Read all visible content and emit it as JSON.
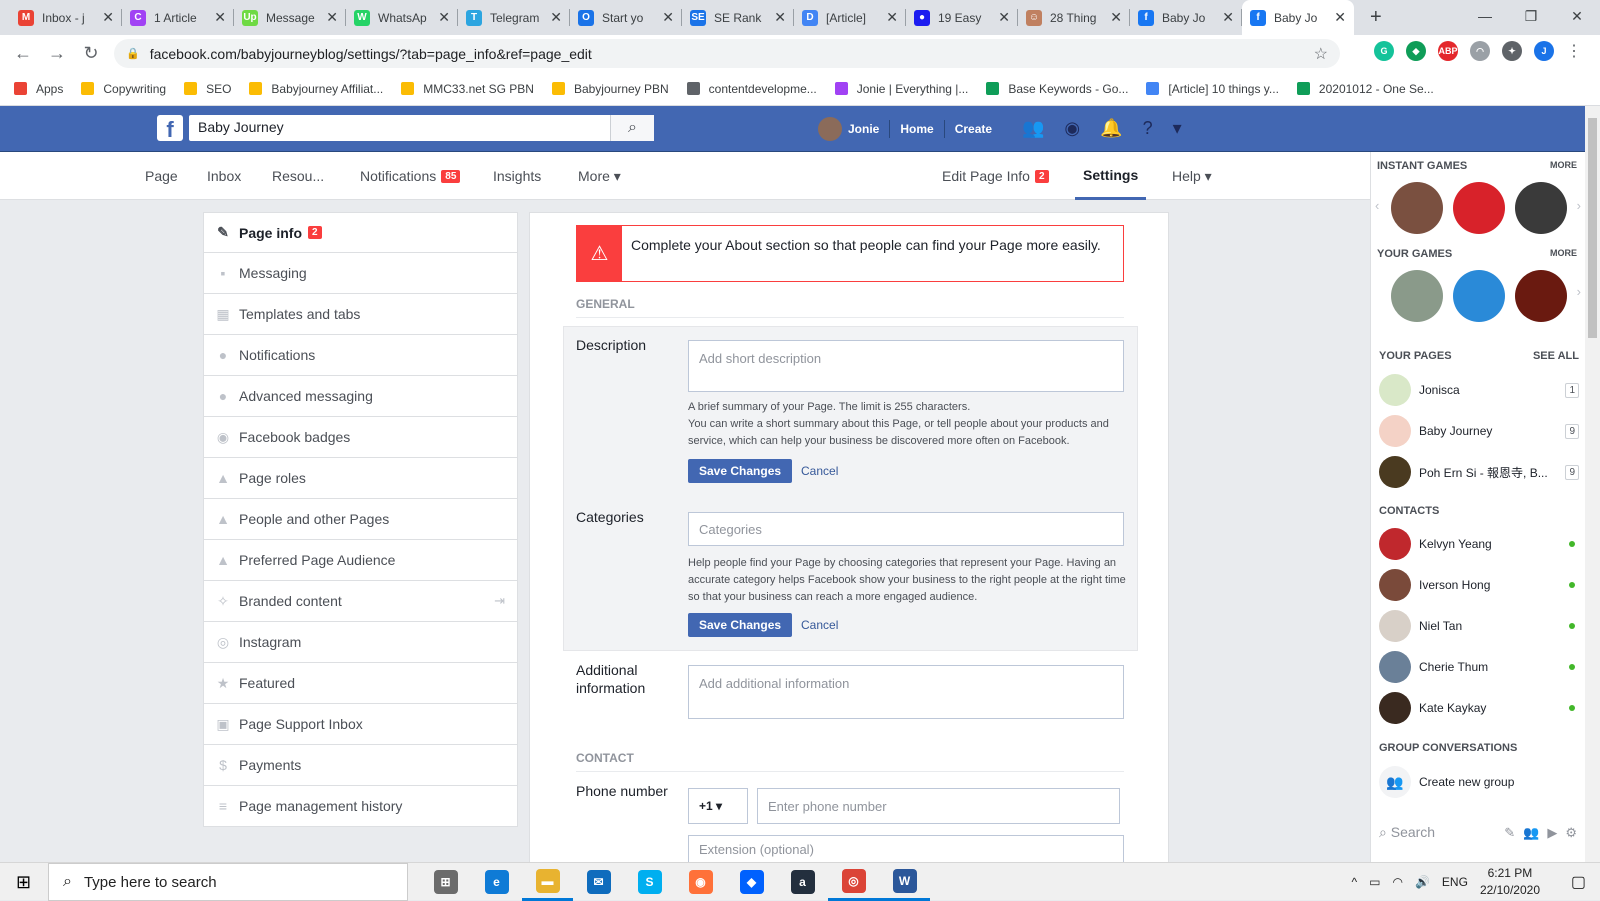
{
  "browser": {
    "tabs": [
      {
        "title": "Inbox - j",
        "color": "#ea4335",
        "glyph": "M",
        "active": false
      },
      {
        "title": "1 Article",
        "color": "#a142f4",
        "glyph": "C",
        "active": false
      },
      {
        "title": "Message",
        "color": "#6fda44",
        "glyph": "Up",
        "active": false
      },
      {
        "title": "WhatsAp",
        "color": "#25d366",
        "glyph": "W",
        "active": false
      },
      {
        "title": "Telegram",
        "color": "#2ca5e0",
        "glyph": "T",
        "active": false
      },
      {
        "title": "Start yo",
        "color": "#1a73e8",
        "glyph": "O",
        "active": false
      },
      {
        "title": "SE Rank",
        "color": "#1a73e8",
        "glyph": "SE",
        "active": false
      },
      {
        "title": "[Article]",
        "color": "#4285f4",
        "glyph": "D",
        "active": false
      },
      {
        "title": "19 Easy",
        "color": "#1c1cf0",
        "glyph": "●",
        "active": false
      },
      {
        "title": "28 Thing",
        "color": "#c08060",
        "glyph": "☺",
        "active": false
      },
      {
        "title": "Baby Jo",
        "color": "#1877f2",
        "glyph": "f",
        "active": false
      },
      {
        "title": "Baby Jo",
        "color": "#1877f2",
        "glyph": "f",
        "active": true
      }
    ],
    "new_tab": "+",
    "url": "facebook.com/babyjourneyblog/settings/?tab=page_info&ref=page_edit",
    "extensions": [
      {
        "glyph": "G",
        "color": "#15c39a"
      },
      {
        "glyph": "◆",
        "color": "#0f9d58"
      },
      {
        "glyph": "ABP",
        "color": "#e4282c"
      },
      {
        "glyph": "◠",
        "color": "#9aa0a6"
      },
      {
        "glyph": "✦",
        "color": "#5f6368"
      },
      {
        "glyph": "J",
        "color": "#1a73e8"
      }
    ],
    "bookmarks": [
      {
        "label": "Apps",
        "color": "#ea4335"
      },
      {
        "label": "Copywriting",
        "color": "#fbbc04"
      },
      {
        "label": "SEO",
        "color": "#fbbc04"
      },
      {
        "label": "Babyjourney Affiliat...",
        "color": "#fbbc04"
      },
      {
        "label": "MMC33.net SG PBN",
        "color": "#fbbc04"
      },
      {
        "label": "Babyjourney PBN",
        "color": "#fbbc04"
      },
      {
        "label": "contentdevelopme...",
        "color": "#5f6368"
      },
      {
        "label": "Jonie | Everything |...",
        "color": "#a142f4"
      },
      {
        "label": "Base Keywords - Go...",
        "color": "#0f9d58"
      },
      {
        "label": "[Article] 10 things y...",
        "color": "#4285f4"
      },
      {
        "label": "20201012 - One Se...",
        "color": "#0f9d58"
      }
    ]
  },
  "fb": {
    "search_value": "Baby Journey",
    "user": "Jonie",
    "home": "Home",
    "create": "Create"
  },
  "page_tabs": {
    "page": "Page",
    "inbox": "Inbox",
    "resources": "Resou...",
    "notifications": "Notifications",
    "notifications_badge": "85",
    "insights": "Insights",
    "more": "More ▾",
    "edit_page_info": "Edit Page Info",
    "edit_badge": "2",
    "settings": "Settings",
    "help": "Help ▾"
  },
  "sidebar": {
    "items": [
      {
        "label": "Page info",
        "icon": "✎",
        "badge": "2",
        "active": true
      },
      {
        "label": "Messaging",
        "icon": "▪",
        "active": false
      },
      {
        "label": "Templates and tabs",
        "icon": "▦",
        "active": false
      },
      {
        "label": "Notifications",
        "icon": "●",
        "active": false
      },
      {
        "label": "Advanced messaging",
        "icon": "●",
        "active": false
      },
      {
        "label": "Facebook badges",
        "icon": "◉",
        "active": false
      },
      {
        "label": "Page roles",
        "icon": "▲",
        "active": false
      },
      {
        "label": "People and other Pages",
        "icon": "▲",
        "active": false
      },
      {
        "label": "Preferred Page Audience",
        "icon": "▲",
        "active": false
      },
      {
        "label": "Branded content",
        "icon": "✧",
        "active": false,
        "trail": "⇥"
      },
      {
        "label": "Instagram",
        "icon": "◎",
        "active": false
      },
      {
        "label": "Featured",
        "icon": "★",
        "active": false
      },
      {
        "label": "Page Support Inbox",
        "icon": "▣",
        "active": false
      },
      {
        "label": "Payments",
        "icon": "$",
        "active": false
      },
      {
        "label": "Page management history",
        "icon": "≡",
        "active": false
      }
    ]
  },
  "main": {
    "alert": "Complete your About section so that people can find your Page more easily.",
    "general_heading": "GENERAL",
    "description_label": "Description",
    "description_placeholder": "Add short description",
    "description_help": "A brief summary of your Page. The limit is 255 characters.\nYou can write a short summary about this Page, or tell people about your products and service, which can help your business be discovered more often on Facebook.",
    "save_changes": "Save Changes",
    "cancel": "Cancel",
    "categories_label": "Categories",
    "categories_placeholder": "Categories",
    "categories_help": "Help people find your Page by choosing categories that represent your Page. Having an accurate category helps Facebook show your business to the right people at the right time so that your business can reach a more engaged audience.",
    "additional_label": "Additional information",
    "additional_placeholder": "Add additional information",
    "contact_heading": "CONTACT",
    "phone_label": "Phone number",
    "country_code": "+1 ▾",
    "phone_placeholder": "Enter phone number",
    "extension_placeholder": "Extension (optional)"
  },
  "right": {
    "instant_games": "INSTANT GAMES",
    "more": "MORE",
    "your_games": "YOUR GAMES",
    "your_pages": "YOUR PAGES",
    "see_all": "SEE ALL",
    "pages": [
      {
        "name": "Jonisca",
        "count": "1",
        "color": "#d9e8c8"
      },
      {
        "name": "Baby Journey",
        "count": "9",
        "color": "#f4d2c6"
      },
      {
        "name": "Poh Ern Si - 報恩寺, B...",
        "count": "9",
        "color": "#4a3a20"
      }
    ],
    "contacts_heading": "CONTACTS",
    "contacts": [
      {
        "name": "Kelvyn Yeang",
        "color": "#c0282d"
      },
      {
        "name": "Iverson Hong",
        "color": "#7a4a3a"
      },
      {
        "name": "Niel Tan",
        "color": "#d8d0c8"
      },
      {
        "name": "Cherie Thum",
        "color": "#6a8098"
      },
      {
        "name": "Kate Kaykay",
        "color": "#3a2a20"
      }
    ],
    "group_heading": "GROUP CONVERSATIONS",
    "create_group": "Create new group",
    "search": "Search"
  },
  "taskbar": {
    "search_placeholder": "Type here to search",
    "apps": [
      {
        "glyph": "⊞",
        "color": "#6b6b6b",
        "run": false
      },
      {
        "glyph": "e",
        "color": "#0f7bd6",
        "run": false
      },
      {
        "glyph": "▬",
        "color": "#e8b330",
        "run": true
      },
      {
        "glyph": "✉",
        "color": "#0f6cbd",
        "run": false
      },
      {
        "glyph": "S",
        "color": "#00aff0",
        "run": false
      },
      {
        "glyph": "◉",
        "color": "#ff7139",
        "run": false
      },
      {
        "glyph": "◆",
        "color": "#0061fe",
        "run": false
      },
      {
        "glyph": "a",
        "color": "#232f3e",
        "run": false
      },
      {
        "glyph": "◎",
        "color": "#db4437",
        "run": true
      },
      {
        "glyph": "W",
        "color": "#2b579a",
        "run": true
      }
    ],
    "lang": "ENG",
    "time": "6:21 PM",
    "date": "22/10/2020"
  }
}
